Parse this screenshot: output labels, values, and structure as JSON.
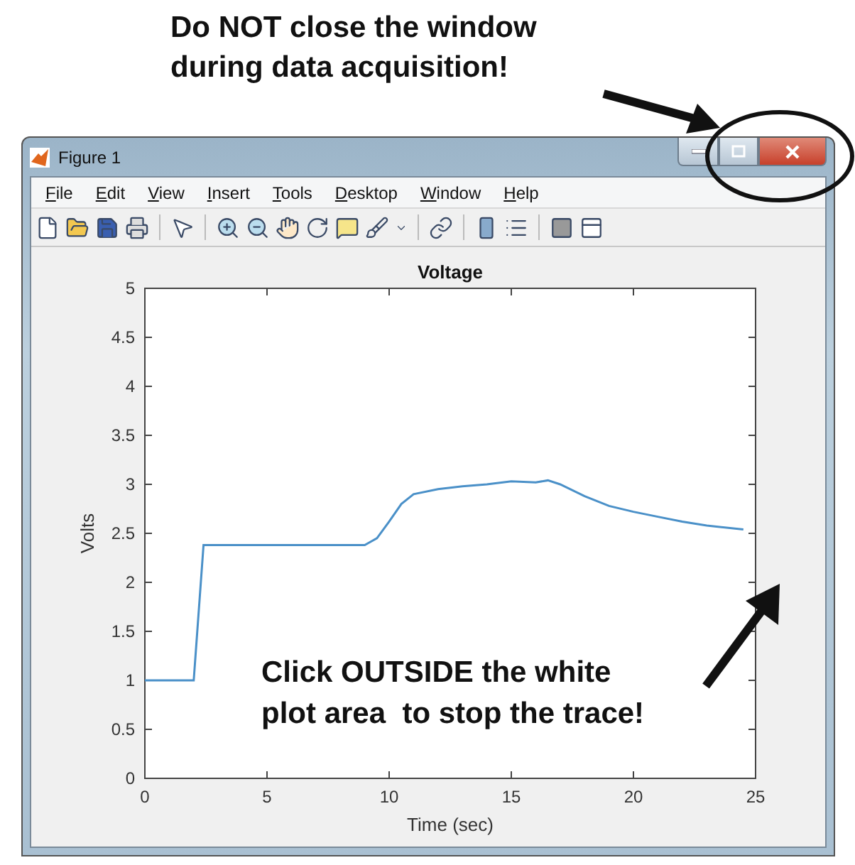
{
  "annotation": {
    "lines": [
      "Do NOT close the window",
      "during data acquisition!"
    ]
  },
  "window": {
    "title": "Figure 1"
  },
  "menu": [
    {
      "label": "File"
    },
    {
      "label": "Edit"
    },
    {
      "label": "View"
    },
    {
      "label": "Insert"
    },
    {
      "label": "Tools"
    },
    {
      "label": "Desktop"
    },
    {
      "label": "Window"
    },
    {
      "label": "Help"
    }
  ],
  "plot": {
    "chart_data": {
      "type": "line",
      "title": "Voltage",
      "xlabel": "Time (sec)",
      "ylabel": "Volts",
      "xlim": [
        0,
        25
      ],
      "ylim": [
        0,
        5
      ],
      "xticks": [
        0,
        5,
        10,
        15,
        20,
        25
      ],
      "yticks": [
        0,
        0.5,
        1,
        1.5,
        2,
        2.5,
        3,
        3.5,
        4,
        4.5,
        5
      ],
      "x": [
        0,
        2,
        2.4,
        9,
        9.5,
        10,
        10.5,
        11,
        12,
        13,
        14,
        15,
        16,
        16.5,
        17,
        18,
        19,
        20,
        21,
        22,
        23,
        24.5
      ],
      "series": [
        {
          "color": "#4a90c8",
          "values": [
            1,
            1,
            2.38,
            2.38,
            2.45,
            2.62,
            2.8,
            2.9,
            2.95,
            2.98,
            3.0,
            3.03,
            3.02,
            3.04,
            3.0,
            2.88,
            2.78,
            2.72,
            2.67,
            2.62,
            2.58,
            2.54
          ]
        }
      ]
    },
    "note": {
      "lines": [
        "Click OUTSIDE the white",
        "plot area  to stop the trace!"
      ]
    }
  }
}
